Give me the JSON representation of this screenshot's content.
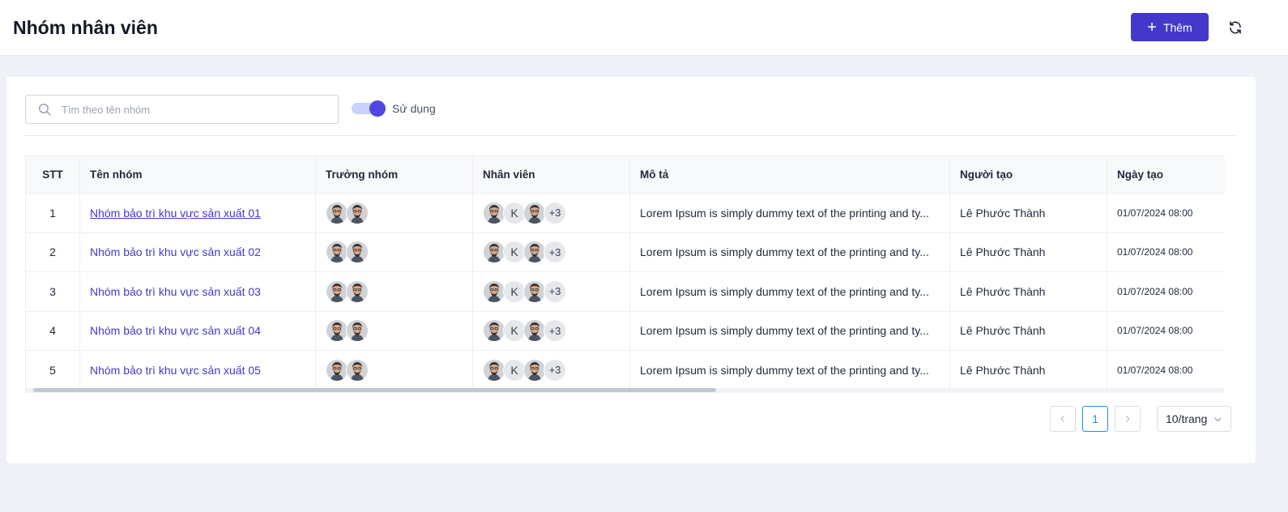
{
  "header": {
    "title": "Nhóm nhân viên",
    "add_label": "Thêm"
  },
  "filters": {
    "search_placeholder": "Tìm theo tên nhóm",
    "toggle_label": "Sử dụng",
    "toggle_on": true
  },
  "table": {
    "columns": [
      "STT",
      "Tên nhóm",
      "Trưởng nhóm",
      "Nhân viên",
      "Mô tả",
      "Người tạo",
      "Ngày tạo"
    ],
    "rows": [
      {
        "stt": "1",
        "name": "Nhóm bảo trì khu vực sản xuất 01",
        "leaders": [
          "face-avatar",
          "face-avatar"
        ],
        "members": [
          "face-avatar",
          "K",
          "face-avatar",
          "+3"
        ],
        "desc": "Lorem Ipsum is simply dummy text of the printing and ty...",
        "creator": "Lê Phước Thành",
        "date": "01/07/2024 08:00"
      },
      {
        "stt": "2",
        "name": "Nhóm bảo trì khu vực sản xuất 02",
        "leaders": [
          "face-avatar",
          "face-avatar"
        ],
        "members": [
          "face-avatar",
          "K",
          "face-avatar",
          "+3"
        ],
        "desc": "Lorem Ipsum is simply dummy text of the printing and ty...",
        "creator": "Lê Phước Thành",
        "date": "01/07/2024 08:00"
      },
      {
        "stt": "3",
        "name": "Nhóm bảo trì khu vực sản xuất 03",
        "leaders": [
          "face-avatar",
          "face-avatar"
        ],
        "members": [
          "face-avatar",
          "K",
          "face-avatar",
          "+3"
        ],
        "desc": "Lorem Ipsum is simply dummy text of the printing and ty...",
        "creator": "Lê Phước Thành",
        "date": "01/07/2024 08:00"
      },
      {
        "stt": "4",
        "name": "Nhóm bảo trì khu vực sản xuất 04",
        "leaders": [
          "face-avatar",
          "face-avatar"
        ],
        "members": [
          "face-avatar",
          "K",
          "face-avatar",
          "+3"
        ],
        "desc": "Lorem Ipsum is simply dummy text of the printing and ty...",
        "creator": "Lê Phước Thành",
        "date": "01/07/2024 08:00"
      },
      {
        "stt": "5",
        "name": "Nhóm bảo trì khu vực sản xuất 05",
        "leaders": [
          "face-avatar",
          "face-avatar"
        ],
        "members": [
          "face-avatar",
          "K",
          "face-avatar",
          "+3"
        ],
        "desc": "Lorem Ipsum is simply dummy text of the printing and ty...",
        "creator": "Lê Phước Thành",
        "date": "01/07/2024 08:00"
      }
    ]
  },
  "pagination": {
    "current_page": "1",
    "page_size_label": "10/trang"
  },
  "colors": {
    "primary": "#4338ca",
    "link": "#4338ca",
    "pager_active": "#1d8cf8",
    "background": "#eef2f6"
  },
  "icons": {
    "add": "plus-icon",
    "refresh": "refresh-icon",
    "search": "search-icon",
    "prev": "chevron-left-icon",
    "next": "chevron-right-icon",
    "dropdown": "chevron-down-icon"
  }
}
